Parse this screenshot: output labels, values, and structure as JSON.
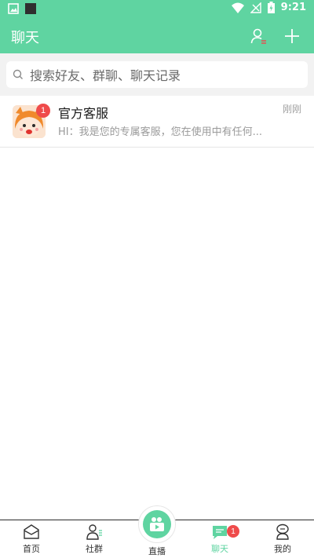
{
  "statusbar": {
    "time": "9:21"
  },
  "appbar": {
    "title": "聊天"
  },
  "search": {
    "placeholder": "搜索好友、群聊、聊天记录"
  },
  "chats": [
    {
      "name": "官方客服",
      "message": "HI：我是您的专属客服，您在使用中有任何...",
      "time": "刚刚",
      "badge": "1"
    }
  ],
  "bottom_nav": [
    {
      "label": "首页",
      "icon": "home-icon"
    },
    {
      "label": "社群",
      "icon": "community-icon"
    },
    {
      "label": "直播",
      "icon": "live-icon"
    },
    {
      "label": "聊天",
      "icon": "chat-icon",
      "badge": "1",
      "active": true
    },
    {
      "label": "我的",
      "icon": "profile-icon"
    }
  ],
  "colors": {
    "accent": "#5fd4a1",
    "badge": "#ef4b4b"
  }
}
